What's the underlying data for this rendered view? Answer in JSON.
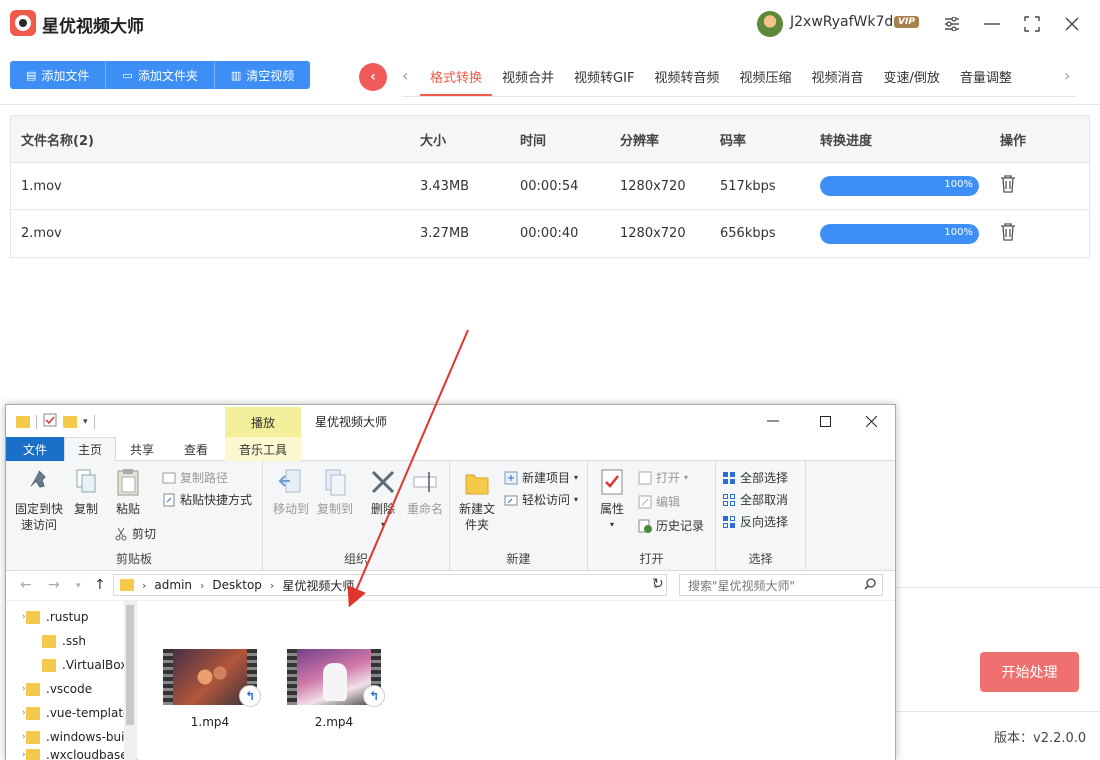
{
  "app": {
    "title": "星优视频大师",
    "username": "J2xwRyafWk7d",
    "vip": "VIP",
    "version": "版本：v2.2.0.0",
    "start_label": "开始处理"
  },
  "toolbar": {
    "add_file": "添加文件",
    "add_folder": "添加文件夹",
    "clear": "清空视频"
  },
  "tabs": [
    "格式转换",
    "视频合并",
    "视频转GIF",
    "视频转音频",
    "视频压缩",
    "视频消音",
    "变速/倒放",
    "音量调整"
  ],
  "table": {
    "headers": {
      "name": "文件名称(2)",
      "size": "大小",
      "time": "时间",
      "resolution": "分辨率",
      "bitrate": "码率",
      "progress": "转换进度",
      "op": "操作"
    },
    "rows": [
      {
        "name": "1.mov",
        "size": "3.43MB",
        "time": "00:00:54",
        "resolution": "1280x720",
        "bitrate": "517kbps",
        "progress": 100,
        "progress_label": "100%"
      },
      {
        "name": "2.mov",
        "size": "3.27MB",
        "time": "00:00:40",
        "resolution": "1280x720",
        "bitrate": "656kbps",
        "progress": 100,
        "progress_label": "100%"
      }
    ]
  },
  "explorer": {
    "title": "星优视频大师",
    "context_tab": "播放",
    "ribbon_tabs": {
      "file": "文件",
      "home": "主页",
      "share": "共享",
      "view": "查看",
      "music": "音乐工具"
    },
    "clipboard": {
      "pin": "固定到快速访问",
      "copy": "复制",
      "paste": "粘贴",
      "copy_path": "复制路径",
      "paste_shortcut": "粘贴快捷方式",
      "cut": "剪切",
      "label": "剪贴板"
    },
    "organize": {
      "move_to": "移动到",
      "copy_to": "复制到",
      "delete": "删除",
      "rename": "重命名",
      "label": "组织"
    },
    "new": {
      "new_folder": "新建文件夹",
      "new_item": "新建项目",
      "easy_access": "轻松访问",
      "label": "新建"
    },
    "open": {
      "properties": "属性",
      "open": "打开",
      "edit": "编辑",
      "history": "历史记录",
      "label": "打开"
    },
    "select": {
      "select_all": "全部选择",
      "select_none": "全部取消",
      "invert": "反向选择",
      "label": "选择"
    },
    "address": [
      "admin",
      "Desktop",
      "星优视频大师"
    ],
    "search_placeholder": "搜索\"星优视频大师\"",
    "tree": [
      ".rustup",
      ".ssh",
      ".VirtualBox",
      ".vscode",
      ".vue-templates",
      ".windows-build-tools",
      ".wxcloudbase"
    ],
    "files": [
      {
        "name": "1.mp4"
      },
      {
        "name": "2.mp4"
      }
    ]
  },
  "colors": {
    "accent": "#3d8ff5",
    "brand_red": "#f05a4a",
    "start_btn": "#f07070",
    "arrow": "#e0352b"
  }
}
